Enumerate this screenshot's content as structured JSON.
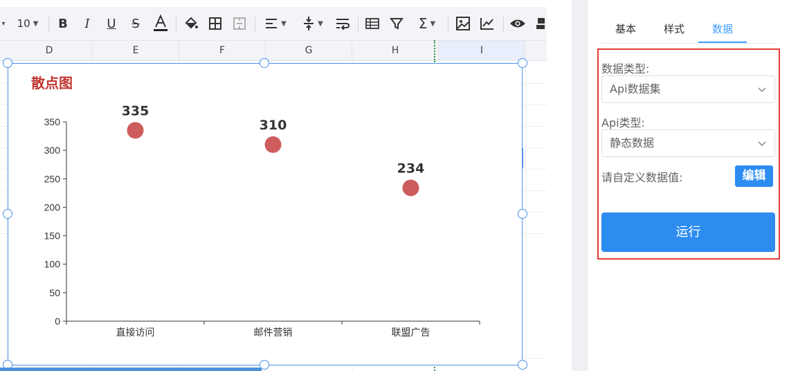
{
  "toolbar": {
    "font_size": "10",
    "icons": [
      "font-size-select",
      "bold-icon",
      "italic-icon",
      "underline-icon",
      "strikethrough-icon",
      "text-color-icon",
      "fill-color-icon",
      "border-icon",
      "merge-cells-icon",
      "align-icon",
      "valign-icon",
      "wrap-text-icon",
      "table-icon",
      "filter-icon",
      "sum-icon",
      "image-icon",
      "chart-icon",
      "preview-eye-icon"
    ]
  },
  "columns": [
    {
      "label": "D",
      "selected": false
    },
    {
      "label": "E",
      "selected": false
    },
    {
      "label": "F",
      "selected": false
    },
    {
      "label": "G",
      "selected": false
    },
    {
      "label": "H",
      "selected": false
    },
    {
      "label": "I",
      "selected": true
    }
  ],
  "chart": {
    "title": "散点图",
    "accent_color": "#c23531",
    "point_color": "#cd5c5c"
  },
  "chart_data": {
    "type": "scatter",
    "title": "散点图",
    "categories": [
      "直接访问",
      "邮件营销",
      "联盟广告"
    ],
    "values": [
      335,
      310,
      234
    ],
    "data_labels": [
      "335",
      "310",
      "234"
    ],
    "xlabel": "",
    "ylabel": "",
    "ylim": [
      0,
      350
    ],
    "yticks": [
      0,
      50,
      100,
      150,
      200,
      250,
      300,
      350
    ],
    "grid": false,
    "legend": "none"
  },
  "panel": {
    "tabs": [
      {
        "label": "基本",
        "active": false
      },
      {
        "label": "样式",
        "active": false
      },
      {
        "label": "数据",
        "active": true
      }
    ],
    "data_type_label": "数据类型:",
    "data_type_value": "Api数据集",
    "api_type_label": "Api类型:",
    "api_type_value": "静态数据",
    "custom_label": "请自定义数据值:",
    "edit_button": "编辑",
    "run_button": "运行",
    "highlight_color": "#e53935",
    "primary_color": "#2d8cf0"
  }
}
